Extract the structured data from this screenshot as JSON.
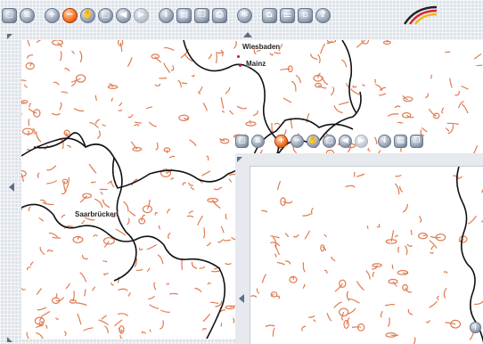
{
  "toolbar_main": {
    "buttons": [
      {
        "icon": "new-page-icon",
        "glyph": "▢"
      },
      {
        "icon": "layers-icon",
        "glyph": "≡"
      },
      {
        "icon": "zoom-in-icon",
        "glyph": "+"
      },
      {
        "icon": "zoom-out-icon",
        "glyph": "−",
        "active": true
      },
      {
        "icon": "pan-hand-icon",
        "glyph": "✋"
      },
      {
        "icon": "zoom-box-icon",
        "glyph": "□"
      },
      {
        "icon": "back-icon",
        "glyph": "◀"
      },
      {
        "icon": "forward-icon",
        "glyph": "▶",
        "disabled": true
      },
      {
        "icon": "info-icon",
        "glyph": "i"
      },
      {
        "icon": "save-icon",
        "glyph": "▤"
      },
      {
        "icon": "copy-icon",
        "glyph": "❐"
      },
      {
        "icon": "print-icon",
        "glyph": "⎙"
      },
      {
        "icon": "settings-icon",
        "glyph": "✻"
      },
      {
        "icon": "overview-icon",
        "glyph": "⌂"
      },
      {
        "icon": "legend-icon",
        "glyph": "☰"
      },
      {
        "icon": "window-icon",
        "glyph": "▫"
      },
      {
        "icon": "help-icon",
        "glyph": "?"
      }
    ]
  },
  "toolbar_inset": {
    "buttons": [
      {
        "icon": "new-page-icon",
        "glyph": "▢"
      },
      {
        "icon": "layers-icon",
        "glyph": "≡"
      },
      {
        "icon": "zoom-in-icon",
        "glyph": "+",
        "active": true
      },
      {
        "icon": "zoom-out-icon",
        "glyph": "−"
      },
      {
        "icon": "pan-hand-icon",
        "glyph": "✋"
      },
      {
        "icon": "zoom-box-icon",
        "glyph": "□"
      },
      {
        "icon": "back-icon",
        "glyph": "◀"
      },
      {
        "icon": "forward-icon",
        "glyph": "▶",
        "disabled": true
      },
      {
        "icon": "info-icon",
        "glyph": "i"
      },
      {
        "icon": "save-icon",
        "glyph": "▤"
      },
      {
        "icon": "copy-icon",
        "glyph": "❐"
      }
    ]
  },
  "map": {
    "cities": [
      {
        "name": "Wiesbaden"
      },
      {
        "name": "Mainz"
      },
      {
        "name": "Saarbrücken"
      }
    ],
    "colors": {
      "border": "#111111",
      "feature": "#e07a4f",
      "city_dot": "#c0182f"
    }
  }
}
